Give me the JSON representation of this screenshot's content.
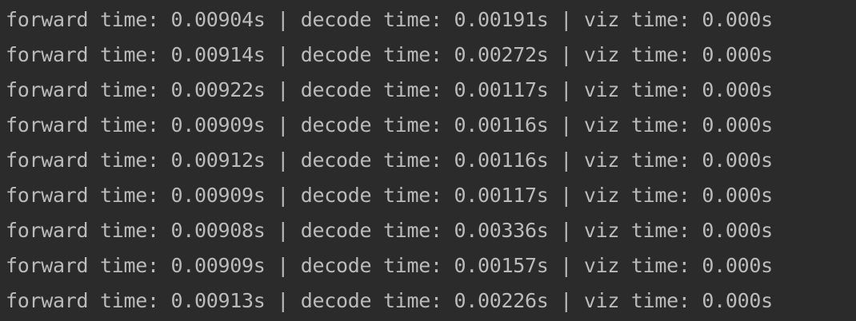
{
  "console": {
    "text_color": "#bbbbbb",
    "background_color": "#2b2b2b",
    "lines": [
      "forward time: 0.00904s | decode time: 0.00191s | viz time: 0.000s",
      "forward time: 0.00914s | decode time: 0.00272s | viz time: 0.000s",
      "forward time: 0.00922s | decode time: 0.00117s | viz time: 0.000s",
      "forward time: 0.00909s | decode time: 0.00116s | viz time: 0.000s",
      "forward time: 0.00912s | decode time: 0.00116s | viz time: 0.000s",
      "forward time: 0.00909s | decode time: 0.00117s | viz time: 0.000s",
      "forward time: 0.00908s | decode time: 0.00336s | viz time: 0.000s",
      "forward time: 0.00909s | decode time: 0.00157s | viz time: 0.000s",
      "forward time: 0.00913s | decode time: 0.00226s | viz time: 0.000s"
    ]
  }
}
